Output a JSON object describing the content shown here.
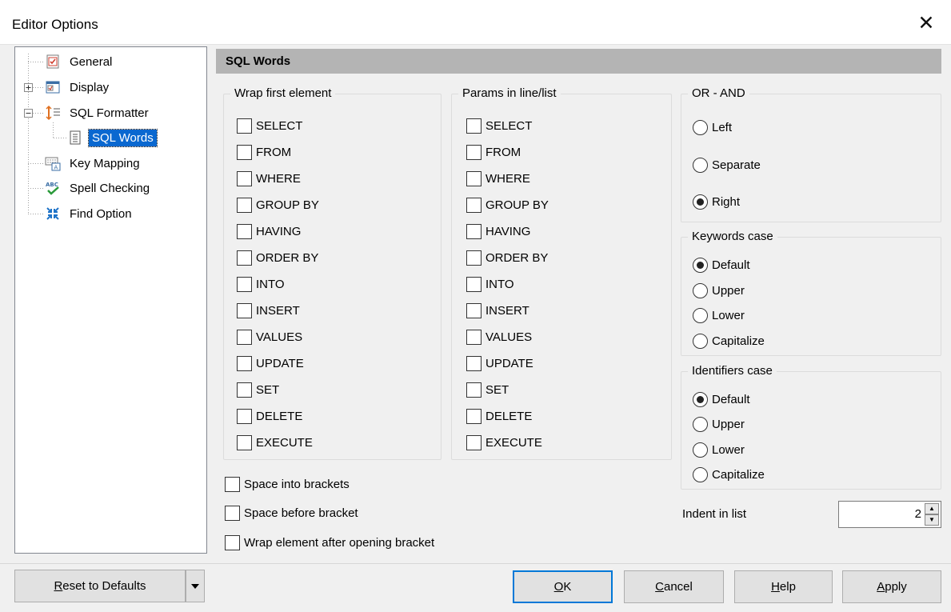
{
  "window": {
    "title": "Editor Options",
    "close_glyph": "✕"
  },
  "tree": {
    "items": [
      {
        "label": "General",
        "icon": "general-icon"
      },
      {
        "label": "Display",
        "icon": "display-icon"
      },
      {
        "label": "SQL Formatter",
        "icon": "sql-formatter-icon"
      },
      {
        "label": "SQL Words",
        "icon": "sql-words-icon",
        "selected": true
      },
      {
        "label": "Key Mapping",
        "icon": "key-mapping-icon"
      },
      {
        "label": "Spell Checking",
        "icon": "spell-checking-icon"
      },
      {
        "label": "Find Option",
        "icon": "find-option-icon"
      }
    ]
  },
  "panel": {
    "header": "SQL Words",
    "wrap_first": {
      "title": "Wrap first element",
      "items": [
        "SELECT",
        "FROM",
        "WHERE",
        "GROUP BY",
        "HAVING",
        "ORDER BY",
        "INTO",
        "INSERT",
        "VALUES",
        "UPDATE",
        "SET",
        "DELETE",
        "EXECUTE"
      ]
    },
    "params": {
      "title": "Params in line/list",
      "items": [
        "SELECT",
        "FROM",
        "WHERE",
        "GROUP BY",
        "HAVING",
        "ORDER BY",
        "INTO",
        "INSERT",
        "VALUES",
        "UPDATE",
        "SET",
        "DELETE",
        "EXECUTE"
      ]
    },
    "or_and": {
      "title": "OR - AND",
      "options": [
        "Left",
        "Separate",
        "Right"
      ],
      "selected": "Right"
    },
    "keywords_case": {
      "title": "Keywords case",
      "options": [
        "Default",
        "Upper",
        "Lower",
        "Capitalize"
      ],
      "selected": "Default"
    },
    "identifiers_case": {
      "title": "Identifiers case",
      "options": [
        "Default",
        "Upper",
        "Lower",
        "Capitalize"
      ],
      "selected": "Default"
    },
    "space_into_brackets": "Space into brackets",
    "space_before_bracket": "Space before bracket",
    "wrap_after_bracket": "Wrap element after opening bracket",
    "indent_label": "Indent in list",
    "indent_value": "2"
  },
  "buttons": {
    "reset": {
      "accel": "R",
      "rest": "eset to Defaults"
    },
    "ok": {
      "accel": "O",
      "rest": "K"
    },
    "cancel": {
      "accel": "C",
      "rest": "ancel"
    },
    "help": {
      "accel": "H",
      "rest": "elp"
    },
    "apply": {
      "accel": "A",
      "rest": "pply"
    }
  },
  "colors": {
    "selection": "#0a68d0",
    "header_bg": "#b4b4b4",
    "default_button_border": "#0078d7"
  }
}
